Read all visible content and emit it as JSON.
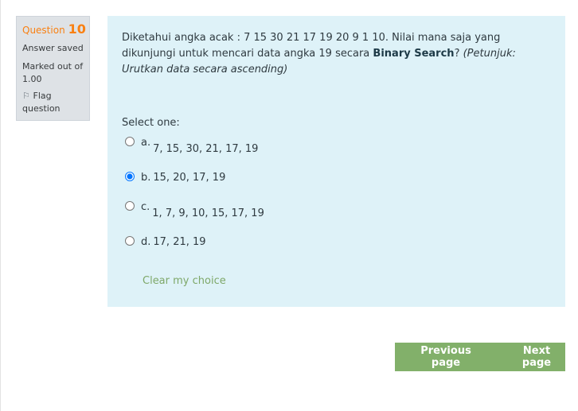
{
  "info": {
    "question_label": "Question",
    "question_number": "10",
    "state": "Answer saved",
    "grade": "Marked out of 1.00",
    "flag_label": "Flag question"
  },
  "question": {
    "text_intro": "Diketahui angka acak : 7 15 30 21 17 19 20 9 1 10. Nilai mana saja yang dikunjungi untuk mencari data angka 19 secara ",
    "text_bold": "Binary Search",
    "text_after": "? ",
    "text_hint": "(Petunjuk: Urutkan data secara ascending)",
    "prompt": "Select one:",
    "options": [
      {
        "letter": "a.",
        "text": "7, 15, 30, 21, 17, 19",
        "selected": false
      },
      {
        "letter": "b.",
        "text": "15, 20, 17, 19",
        "selected": true
      },
      {
        "letter": "c.",
        "text": "1, 7, 9, 10, 15, 17, 19",
        "selected": false
      },
      {
        "letter": "d.",
        "text": "17, 21, 19",
        "selected": false
      }
    ],
    "clear_label": "Clear my choice"
  },
  "navigation": {
    "previous_label": "Previous page",
    "next_label": "Next page"
  },
  "colors": {
    "accent": "#f98012",
    "content_bg": "#def2f8",
    "nav_bg": "#82b06a",
    "link": "#7ea869"
  }
}
